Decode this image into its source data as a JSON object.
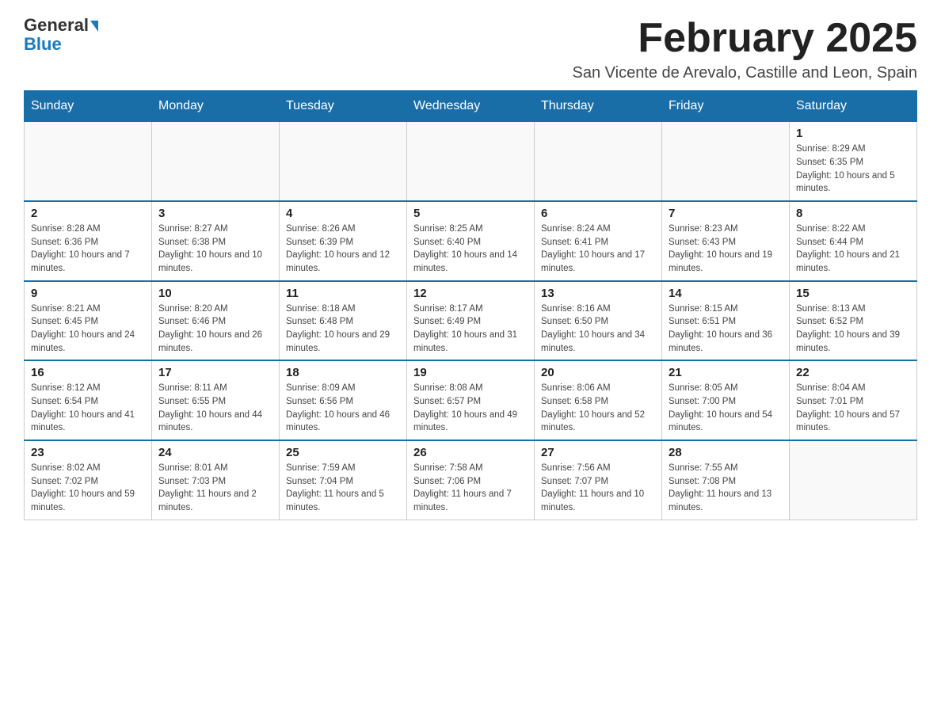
{
  "header": {
    "logo_general": "General",
    "logo_blue": "Blue",
    "month_title": "February 2025",
    "location": "San Vicente de Arevalo, Castille and Leon, Spain"
  },
  "weekdays": [
    "Sunday",
    "Monday",
    "Tuesday",
    "Wednesday",
    "Thursday",
    "Friday",
    "Saturday"
  ],
  "weeks": [
    [
      {
        "day": "",
        "info": ""
      },
      {
        "day": "",
        "info": ""
      },
      {
        "day": "",
        "info": ""
      },
      {
        "day": "",
        "info": ""
      },
      {
        "day": "",
        "info": ""
      },
      {
        "day": "",
        "info": ""
      },
      {
        "day": "1",
        "info": "Sunrise: 8:29 AM\nSunset: 6:35 PM\nDaylight: 10 hours and 5 minutes."
      }
    ],
    [
      {
        "day": "2",
        "info": "Sunrise: 8:28 AM\nSunset: 6:36 PM\nDaylight: 10 hours and 7 minutes."
      },
      {
        "day": "3",
        "info": "Sunrise: 8:27 AM\nSunset: 6:38 PM\nDaylight: 10 hours and 10 minutes."
      },
      {
        "day": "4",
        "info": "Sunrise: 8:26 AM\nSunset: 6:39 PM\nDaylight: 10 hours and 12 minutes."
      },
      {
        "day": "5",
        "info": "Sunrise: 8:25 AM\nSunset: 6:40 PM\nDaylight: 10 hours and 14 minutes."
      },
      {
        "day": "6",
        "info": "Sunrise: 8:24 AM\nSunset: 6:41 PM\nDaylight: 10 hours and 17 minutes."
      },
      {
        "day": "7",
        "info": "Sunrise: 8:23 AM\nSunset: 6:43 PM\nDaylight: 10 hours and 19 minutes."
      },
      {
        "day": "8",
        "info": "Sunrise: 8:22 AM\nSunset: 6:44 PM\nDaylight: 10 hours and 21 minutes."
      }
    ],
    [
      {
        "day": "9",
        "info": "Sunrise: 8:21 AM\nSunset: 6:45 PM\nDaylight: 10 hours and 24 minutes."
      },
      {
        "day": "10",
        "info": "Sunrise: 8:20 AM\nSunset: 6:46 PM\nDaylight: 10 hours and 26 minutes."
      },
      {
        "day": "11",
        "info": "Sunrise: 8:18 AM\nSunset: 6:48 PM\nDaylight: 10 hours and 29 minutes."
      },
      {
        "day": "12",
        "info": "Sunrise: 8:17 AM\nSunset: 6:49 PM\nDaylight: 10 hours and 31 minutes."
      },
      {
        "day": "13",
        "info": "Sunrise: 8:16 AM\nSunset: 6:50 PM\nDaylight: 10 hours and 34 minutes."
      },
      {
        "day": "14",
        "info": "Sunrise: 8:15 AM\nSunset: 6:51 PM\nDaylight: 10 hours and 36 minutes."
      },
      {
        "day": "15",
        "info": "Sunrise: 8:13 AM\nSunset: 6:52 PM\nDaylight: 10 hours and 39 minutes."
      }
    ],
    [
      {
        "day": "16",
        "info": "Sunrise: 8:12 AM\nSunset: 6:54 PM\nDaylight: 10 hours and 41 minutes."
      },
      {
        "day": "17",
        "info": "Sunrise: 8:11 AM\nSunset: 6:55 PM\nDaylight: 10 hours and 44 minutes."
      },
      {
        "day": "18",
        "info": "Sunrise: 8:09 AM\nSunset: 6:56 PM\nDaylight: 10 hours and 46 minutes."
      },
      {
        "day": "19",
        "info": "Sunrise: 8:08 AM\nSunset: 6:57 PM\nDaylight: 10 hours and 49 minutes."
      },
      {
        "day": "20",
        "info": "Sunrise: 8:06 AM\nSunset: 6:58 PM\nDaylight: 10 hours and 52 minutes."
      },
      {
        "day": "21",
        "info": "Sunrise: 8:05 AM\nSunset: 7:00 PM\nDaylight: 10 hours and 54 minutes."
      },
      {
        "day": "22",
        "info": "Sunrise: 8:04 AM\nSunset: 7:01 PM\nDaylight: 10 hours and 57 minutes."
      }
    ],
    [
      {
        "day": "23",
        "info": "Sunrise: 8:02 AM\nSunset: 7:02 PM\nDaylight: 10 hours and 59 minutes."
      },
      {
        "day": "24",
        "info": "Sunrise: 8:01 AM\nSunset: 7:03 PM\nDaylight: 11 hours and 2 minutes."
      },
      {
        "day": "25",
        "info": "Sunrise: 7:59 AM\nSunset: 7:04 PM\nDaylight: 11 hours and 5 minutes."
      },
      {
        "day": "26",
        "info": "Sunrise: 7:58 AM\nSunset: 7:06 PM\nDaylight: 11 hours and 7 minutes."
      },
      {
        "day": "27",
        "info": "Sunrise: 7:56 AM\nSunset: 7:07 PM\nDaylight: 11 hours and 10 minutes."
      },
      {
        "day": "28",
        "info": "Sunrise: 7:55 AM\nSunset: 7:08 PM\nDaylight: 11 hours and 13 minutes."
      },
      {
        "day": "",
        "info": ""
      }
    ]
  ]
}
